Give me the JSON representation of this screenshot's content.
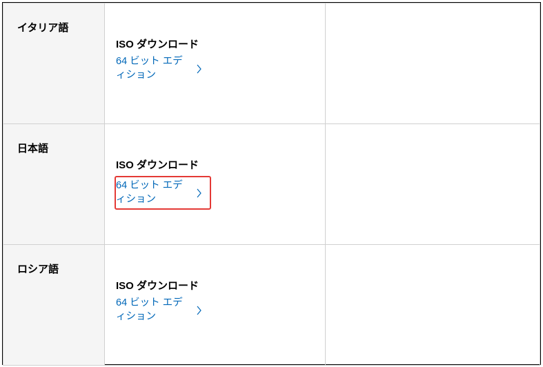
{
  "rows": [
    {
      "language": "イタリア語",
      "iso_label": "ISO ダウンロード",
      "link_text": "64 ビット エディション",
      "highlighted": false
    },
    {
      "language": "日本語",
      "iso_label": "ISO ダウンロード",
      "link_text": "64 ビット エディション",
      "highlighted": true
    },
    {
      "language": "ロシア語",
      "iso_label": "ISO ダウンロード",
      "link_text": "64 ビット エディション",
      "highlighted": false
    }
  ]
}
